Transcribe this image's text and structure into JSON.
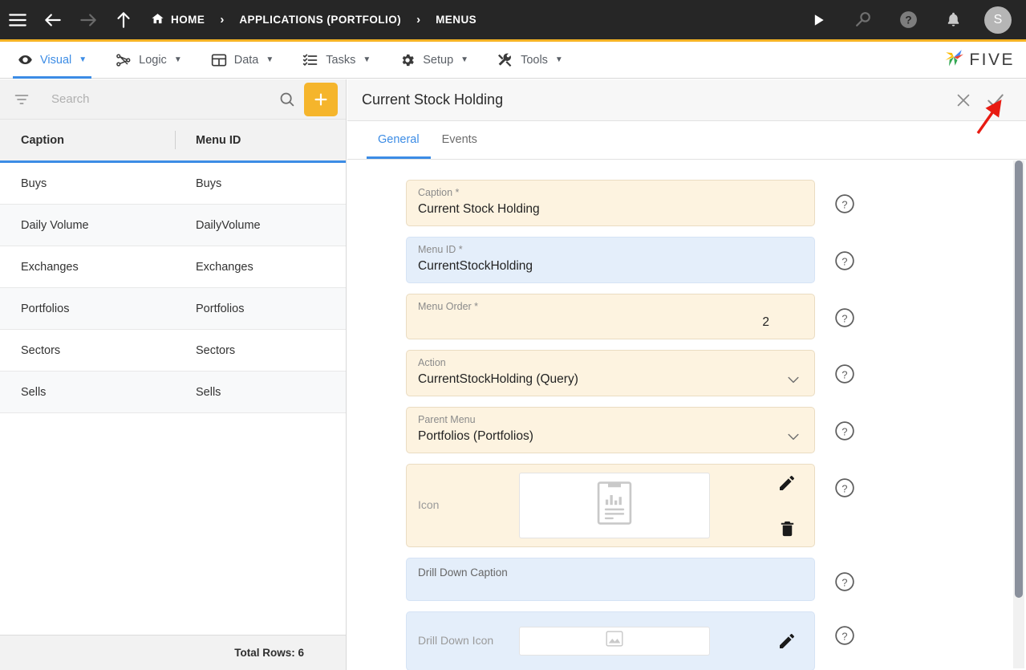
{
  "topbar": {
    "menu_icon": "hamburger-icon",
    "back_icon": "arrow-left-icon",
    "forward_icon": "arrow-right-icon",
    "up_icon": "arrow-up-icon",
    "breadcrumbs": [
      {
        "label": "HOME",
        "icon": "home-icon"
      },
      {
        "label": "APPLICATIONS (PORTFOLIO)",
        "icon": ""
      },
      {
        "label": "MENUS",
        "icon": ""
      }
    ],
    "separator": "›",
    "actions": [
      {
        "name": "run-icon",
        "label": "Run"
      },
      {
        "name": "search-icon",
        "label": "Search"
      },
      {
        "name": "help-icon",
        "label": "Help"
      },
      {
        "name": "notifications-bell-icon",
        "label": "Notifications"
      }
    ],
    "avatar_initial": "S"
  },
  "menustrip": {
    "items": [
      {
        "label": "Visual",
        "icon": "eye-icon",
        "caret": "▼",
        "active": true
      },
      {
        "label": "Logic",
        "icon": "logic-nodes-icon",
        "caret": "▼",
        "active": false
      },
      {
        "label": "Data",
        "icon": "table-grid-icon",
        "caret": "▼",
        "active": false
      },
      {
        "label": "Tasks",
        "icon": "checklist-icon",
        "caret": "▼",
        "active": false
      },
      {
        "label": "Setup",
        "icon": "gear-icon",
        "caret": "▼",
        "active": false
      },
      {
        "label": "Tools",
        "icon": "tools-wrench-icon",
        "caret": "▼",
        "active": false
      }
    ],
    "brand": "FIVE"
  },
  "sidebar": {
    "search": {
      "value": "",
      "placeholder": "Search"
    },
    "filter_icon": "filter-icon",
    "search_icon": "search-icon",
    "add_label": "+",
    "columns": [
      "Caption",
      "Menu ID"
    ],
    "rows": [
      {
        "caption": "Buys",
        "menu_id": "Buys"
      },
      {
        "caption": "Daily Volume",
        "menu_id": "DailyVolume"
      },
      {
        "caption": "Exchanges",
        "menu_id": "Exchanges"
      },
      {
        "caption": "Portfolios",
        "menu_id": "Portfolios"
      },
      {
        "caption": "Sectors",
        "menu_id": "Sectors"
      },
      {
        "caption": "Sells",
        "menu_id": "Sells"
      }
    ],
    "total_rows": "Total Rows: 6"
  },
  "detail": {
    "title": "Current Stock Holding",
    "close_icon": "close-x-icon",
    "save_icon": "checkmark-icon",
    "tabs": [
      {
        "label": "General",
        "active": true
      },
      {
        "label": "Events",
        "active": false
      }
    ],
    "fields": [
      {
        "label": "Caption *",
        "value": "Current Stock Holding",
        "type": "text",
        "tone": "cream",
        "align": "left"
      },
      {
        "label": "Menu ID *",
        "value": "CurrentStockHolding",
        "type": "text",
        "tone": "blue",
        "align": "left"
      },
      {
        "label": "Menu Order *",
        "value": "2",
        "type": "text",
        "tone": "cream",
        "align": "right"
      },
      {
        "label": "Action",
        "value": "CurrentStockHolding (Query)",
        "type": "select",
        "tone": "cream",
        "align": "left"
      },
      {
        "label": "Parent Menu",
        "value": "Portfolios (Portfolios)",
        "type": "select",
        "tone": "cream",
        "align": "left"
      },
      {
        "label": "Icon",
        "value": "",
        "type": "image",
        "tone": "cream",
        "image_icon": "report-clipboard-icon",
        "actions": [
          "pencil-edit-icon",
          "trash-delete-icon"
        ]
      },
      {
        "label": "Drill Down Caption",
        "value": "",
        "type": "text",
        "tone": "blue",
        "align": "left"
      },
      {
        "label": "Drill Down Icon",
        "value": "",
        "type": "image-small",
        "tone": "blue",
        "image_icon": "image-placeholder-icon",
        "actions": [
          "pencil-edit-icon"
        ]
      }
    ],
    "help_icon": "question-circle-icon",
    "chevron_icon": "chevron-down-icon"
  },
  "annotation": {
    "type": "red-arrow",
    "points_to": "save-checkmark-button"
  },
  "colors": {
    "topbar_bg": "#262626",
    "accent_yellow": "#f5b324",
    "accent_blue": "#3c8ce5",
    "field_cream": "#fdf3e0",
    "field_blue": "#e4eefa",
    "annotation_red": "#e81b12"
  }
}
